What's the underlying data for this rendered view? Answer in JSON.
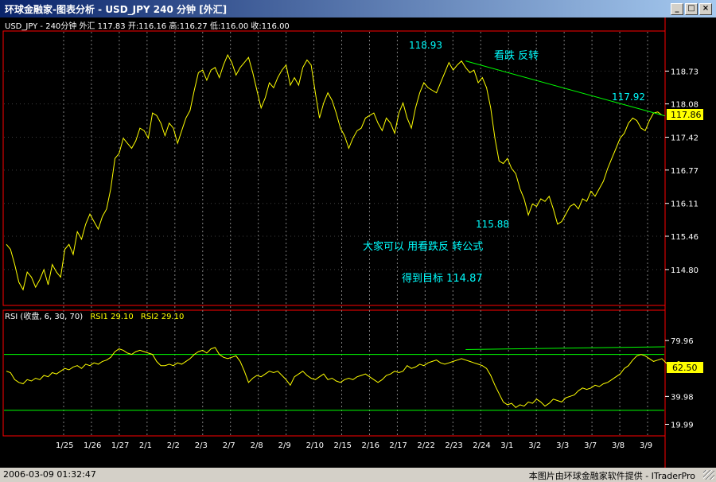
{
  "window": {
    "title": "环球金融家-图表分析 - USD_JPY  240 分钟  [外汇]",
    "minimize_label": "_",
    "maximize_label": "□",
    "close_label": "×"
  },
  "colors": {
    "price_line": "#ffff00",
    "trend_line": "#00ff00",
    "annotation": "#00ffff",
    "frame": "#ff0000",
    "grid": "#808080",
    "axis_text": "#ffffff"
  },
  "price_panel": {
    "header": "USD_JPY - 240分钟 外汇 117.83 开:116.16 高:116.27 低:116.00 收:116.00",
    "last_value_tag": "117.86",
    "annotations": [
      "118.93",
      "看跌 反转",
      "117.92",
      "115.88",
      "大家可以 用看跌反 转公式",
      "得到目标 114.87"
    ]
  },
  "rsi_panel": {
    "header_label": "RSI (收盘, 6, 30, 70)",
    "rsi1_label": "RSI1 29.10",
    "rsi2_label": "RSI2 29.10",
    "last_value_tag": "62.50"
  },
  "status": {
    "time": "2006-03-09  01:32:47",
    "credit": "本图片由环球金融家软件提供 - ITraderPro"
  },
  "chart_data": [
    {
      "type": "line",
      "series": [
        {
          "values": [
            115.3,
            115.2,
            114.9,
            114.55,
            114.4,
            114.75,
            114.65,
            114.45,
            114.6,
            114.8,
            114.5,
            114.9,
            114.75,
            114.65,
            115.2,
            115.3,
            115.1,
            115.55,
            115.4,
            115.7,
            115.9,
            115.75,
            115.6,
            115.85,
            116.0,
            116.4,
            117.0,
            117.1,
            117.4,
            117.3,
            117.2,
            117.35,
            117.6,
            117.55,
            117.4,
            117.9,
            117.85,
            117.7,
            117.45,
            117.7,
            117.6,
            117.3,
            117.55,
            117.8,
            117.95,
            118.35,
            118.7,
            118.75,
            118.55,
            118.75,
            118.8,
            118.6,
            118.85,
            119.05,
            118.9,
            118.65,
            118.8,
            118.9,
            119.0,
            118.7,
            118.35,
            118.0,
            118.2,
            118.5,
            118.4,
            118.6,
            118.75,
            118.85,
            118.45,
            118.6,
            118.45,
            118.8,
            118.95,
            118.85,
            118.3,
            117.8,
            118.1,
            118.3,
            118.15,
            117.9,
            117.6,
            117.45,
            117.2,
            117.4,
            117.55,
            117.6,
            117.8,
            117.85,
            117.9,
            117.7,
            117.55,
            117.8,
            117.7,
            117.5,
            117.9,
            118.1,
            117.8,
            117.6,
            118.0,
            118.3,
            118.5,
            118.4,
            118.35,
            118.3,
            118.5,
            118.7,
            118.9,
            118.75,
            118.85,
            118.93,
            118.8,
            118.7,
            118.75,
            118.5,
            118.6,
            118.4,
            118.0,
            117.4,
            116.95,
            116.9,
            117.0,
            116.8,
            116.7,
            116.4,
            116.2,
            115.88,
            116.1,
            116.05,
            116.2,
            116.15,
            116.25,
            116.0,
            115.7,
            115.75,
            115.9,
            116.05,
            116.1,
            116.0,
            116.2,
            116.15,
            116.35,
            116.25,
            116.4,
            116.55,
            116.8,
            117.0,
            117.2,
            117.4,
            117.5,
            117.7,
            117.8,
            117.75,
            117.6,
            117.55,
            117.75,
            117.9,
            117.92,
            117.86
          ]
        }
      ],
      "x_tick_labels": [
        "1/25",
        "1/26",
        "1/27",
        "2/1",
        "2/2",
        "2/3",
        "2/7",
        "2/8",
        "2/9",
        "2/10",
        "2/15",
        "2/16",
        "2/17",
        "2/22",
        "2/23",
        "2/24",
        "3/1",
        "3/2",
        "3/3",
        "3/7",
        "3/8",
        "3/9"
      ],
      "y_tick_labels": [
        "118.73",
        "118.08",
        "117.42",
        "116.77",
        "116.11",
        "115.46",
        "114.80"
      ],
      "ylim": [
        114.2,
        119.35
      ],
      "trend_line": [
        [
          110,
          118.93
        ],
        [
          164,
          117.7
        ]
      ],
      "grid": true
    },
    {
      "type": "line",
      "series": [
        {
          "values": [
            58,
            57,
            52,
            50,
            49,
            52,
            51,
            53,
            52,
            55,
            54,
            57,
            56,
            58,
            60,
            59,
            61,
            62,
            60,
            63,
            62,
            64,
            63,
            65,
            66,
            68,
            72,
            74,
            73,
            71,
            70,
            72,
            73,
            72,
            71,
            70,
            65,
            62,
            62,
            63,
            62,
            64,
            63,
            65,
            67,
            70,
            72,
            73,
            71,
            74,
            75,
            70,
            68,
            67,
            68,
            69,
            65,
            58,
            50,
            53,
            55,
            54,
            56,
            58,
            57,
            58,
            55,
            52,
            48,
            54,
            56,
            58,
            55,
            53,
            52,
            54,
            56,
            52,
            53,
            51,
            50,
            52,
            53,
            52,
            54,
            55,
            56,
            54,
            52,
            50,
            52,
            55,
            56,
            58,
            57,
            58,
            62,
            60,
            61,
            63,
            62,
            64,
            65,
            66,
            64,
            63,
            64,
            65,
            66,
            67,
            66,
            65,
            64,
            63,
            62,
            60,
            55,
            48,
            42,
            36,
            34,
            35,
            32,
            34,
            33,
            36,
            35,
            38,
            36,
            33,
            35,
            38,
            37,
            36,
            39,
            40,
            41,
            44,
            46,
            45,
            46,
            48,
            47,
            49,
            50,
            52,
            54,
            56,
            60,
            62,
            66,
            69,
            70,
            69,
            67,
            65,
            66,
            67,
            64,
            62,
            63,
            65,
            63,
            62
          ],
          "color": "#ffff00"
        }
      ],
      "y_tick_labels": [
        "79.96",
        "39.98",
        "19.99"
      ],
      "ylim": [
        14,
        92
      ],
      "reference_lines": [
        70,
        30
      ],
      "grid": true
    }
  ]
}
